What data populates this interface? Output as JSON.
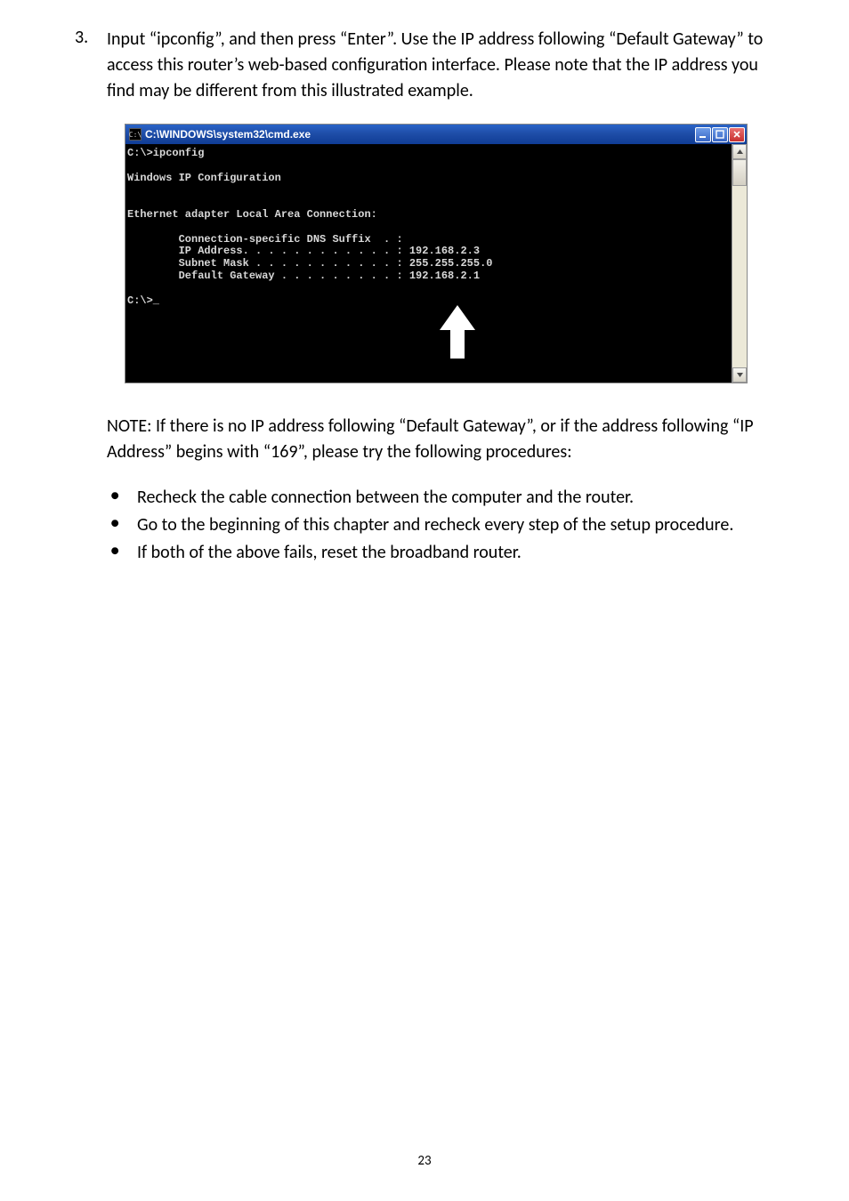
{
  "step": {
    "number": "3.",
    "text": "Input “ipconfig”, and then press “Enter”. Use the IP address following “Default Gateway” to access this router’s web-based configuration interface. Please note that the IP address you find may be different from this illustrated example."
  },
  "console": {
    "icon_glyph": "C:\\",
    "title": "C:\\WINDOWS\\system32\\cmd.exe",
    "lines": {
      "l1": "C:\\>ipconfig",
      "l2": "",
      "l3": "Windows IP Configuration",
      "l4": "",
      "l5": "",
      "l6": "Ethernet adapter Local Area Connection:",
      "l7": "",
      "l8": "        Connection-specific DNS Suffix  . :",
      "l9": "        IP Address. . . . . . . . . . . . : 192.168.2.3",
      "l10": "        Subnet Mask . . . . . . . . . . . : 255.255.255.0",
      "l11": "        Default Gateway . . . . . . . . . : 192.168.2.1",
      "l12": "",
      "l13": "C:\\>_"
    }
  },
  "note": "NOTE: If there is no IP address following “Default Gateway”, or if the address following “IP Address” begins with “169”, please try the following procedures:",
  "bullets": [
    "Recheck the cable connection between the computer and the router.",
    "Go to the beginning of this chapter and recheck every step of the setup procedure.",
    "If both of the above fails, reset the broadband router."
  ],
  "page_number": "23"
}
